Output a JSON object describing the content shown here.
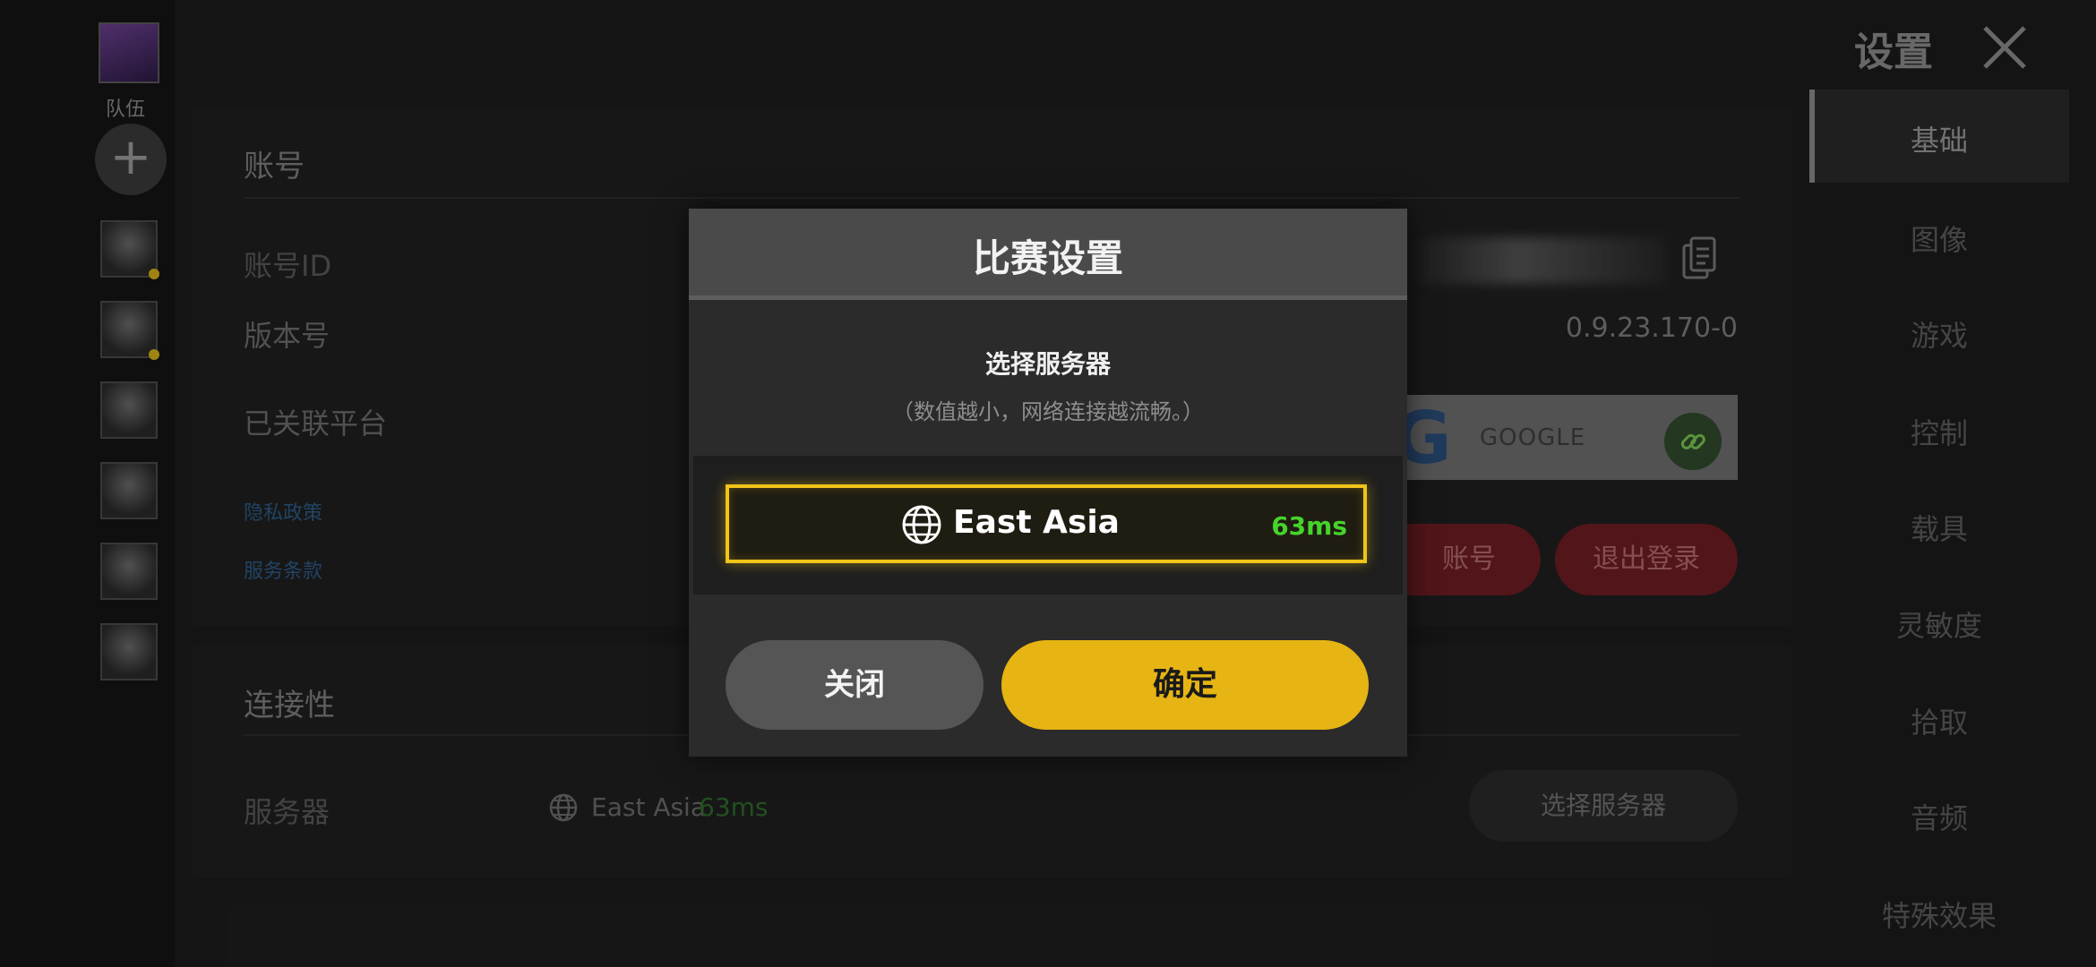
{
  "rail": {
    "team_label": "队伍",
    "add_symbol": "+"
  },
  "account": {
    "section_title": "账号",
    "account_id_label": "账号ID",
    "version_label": "版本号",
    "version_value": "0.9.23.170-0",
    "linked_platforms_label": "已关联平台",
    "privacy_link": "隐私政策",
    "terms_link": "服务条款",
    "google_label": "GOOGLE",
    "account_button_partial": "账号",
    "logout_button": "退出登录"
  },
  "connectivity": {
    "section_title": "连接性",
    "server_label": "服务器",
    "server_name": "East Asia",
    "server_ping": "63ms",
    "select_server_button": "选择服务器"
  },
  "sidebar": {
    "title": "设置",
    "items": [
      {
        "label": "基础"
      },
      {
        "label": "图像"
      },
      {
        "label": "游戏"
      },
      {
        "label": "控制"
      },
      {
        "label": "载具"
      },
      {
        "label": "灵敏度"
      },
      {
        "label": "拾取"
      },
      {
        "label": "音频"
      },
      {
        "label": "特殊效果"
      }
    ],
    "active_index": 0
  },
  "modal": {
    "title": "比赛设置",
    "subtitle": "选择服务器",
    "hint": "（数值越小，网络连接越流畅。）",
    "option": {
      "name": "East Asia",
      "ping": "63ms",
      "icon": "globe-icon"
    },
    "close_button": "关闭",
    "confirm_button": "确定"
  },
  "colors": {
    "accent_yellow": "#e6b413",
    "ping_green": "#46d32c",
    "danger_red": "#6e1d22"
  }
}
